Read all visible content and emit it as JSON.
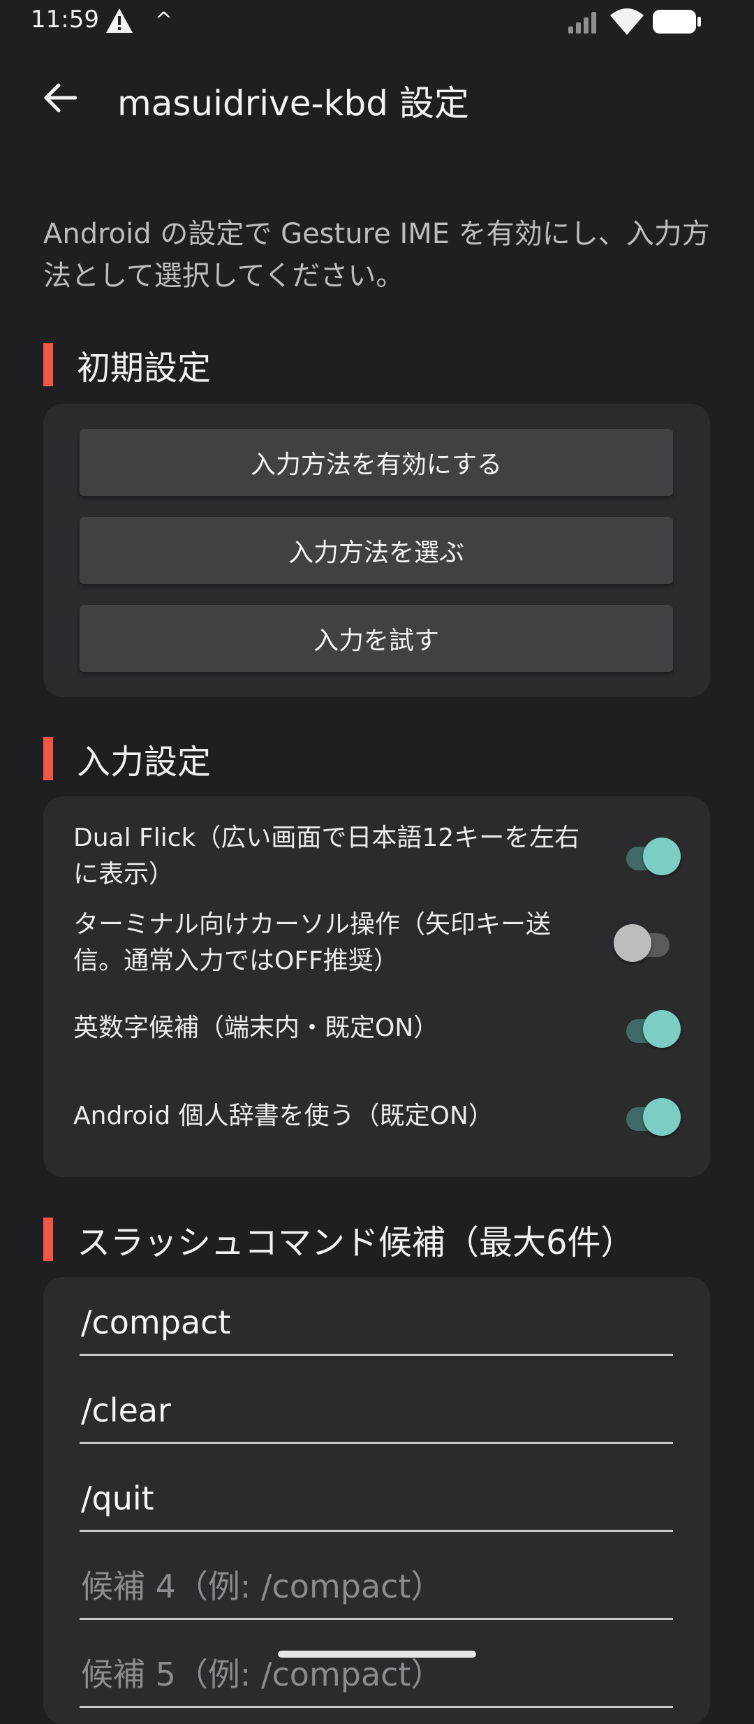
{
  "status_bar": {
    "time": "11:59",
    "icons": [
      "warning-icon",
      "caret-up-icon",
      "signal-icon",
      "wifi-icon",
      "battery-icon"
    ],
    "caret_glyph": "^"
  },
  "app_bar": {
    "title": "masuidrive-kbd 設定",
    "back_icon": "arrow-left-icon"
  },
  "intro_text": "Android の設定で Gesture IME を有効にし、入力方法として選択してください。",
  "sections": {
    "initial": {
      "title": "初期設定",
      "buttons": [
        "入力方法を有効にする",
        "入力方法を選ぶ",
        "入力を試す"
      ]
    },
    "input": {
      "title": "入力設定",
      "toggles": [
        {
          "label": "Dual Flick（広い画面で日本語12キーを左右に表示）",
          "on": true
        },
        {
          "label": "ターミナル向けカーソル操作（矢印キー送信。通常入力ではOFF推奨）",
          "on": false
        },
        {
          "label": "英数字候補（端末内・既定ON）",
          "on": true
        },
        {
          "label": "Android 個人辞書を使う（既定ON）",
          "on": true
        }
      ]
    },
    "slash": {
      "title": "スラッシュコマンド候補（最大6件）",
      "fields": [
        {
          "value": "/compact",
          "placeholder": ""
        },
        {
          "value": "/clear",
          "placeholder": ""
        },
        {
          "value": "/quit",
          "placeholder": ""
        },
        {
          "value": "",
          "placeholder": "候補 4（例: /compact）"
        },
        {
          "value": "",
          "placeholder": "候補 5（例: /compact）"
        }
      ]
    }
  },
  "colors": {
    "background": "#1f1f21",
    "card": "#2b2b2e",
    "accent_bar": "#f2564b",
    "switch_on": "#7ccdc3",
    "button": "#414144"
  }
}
